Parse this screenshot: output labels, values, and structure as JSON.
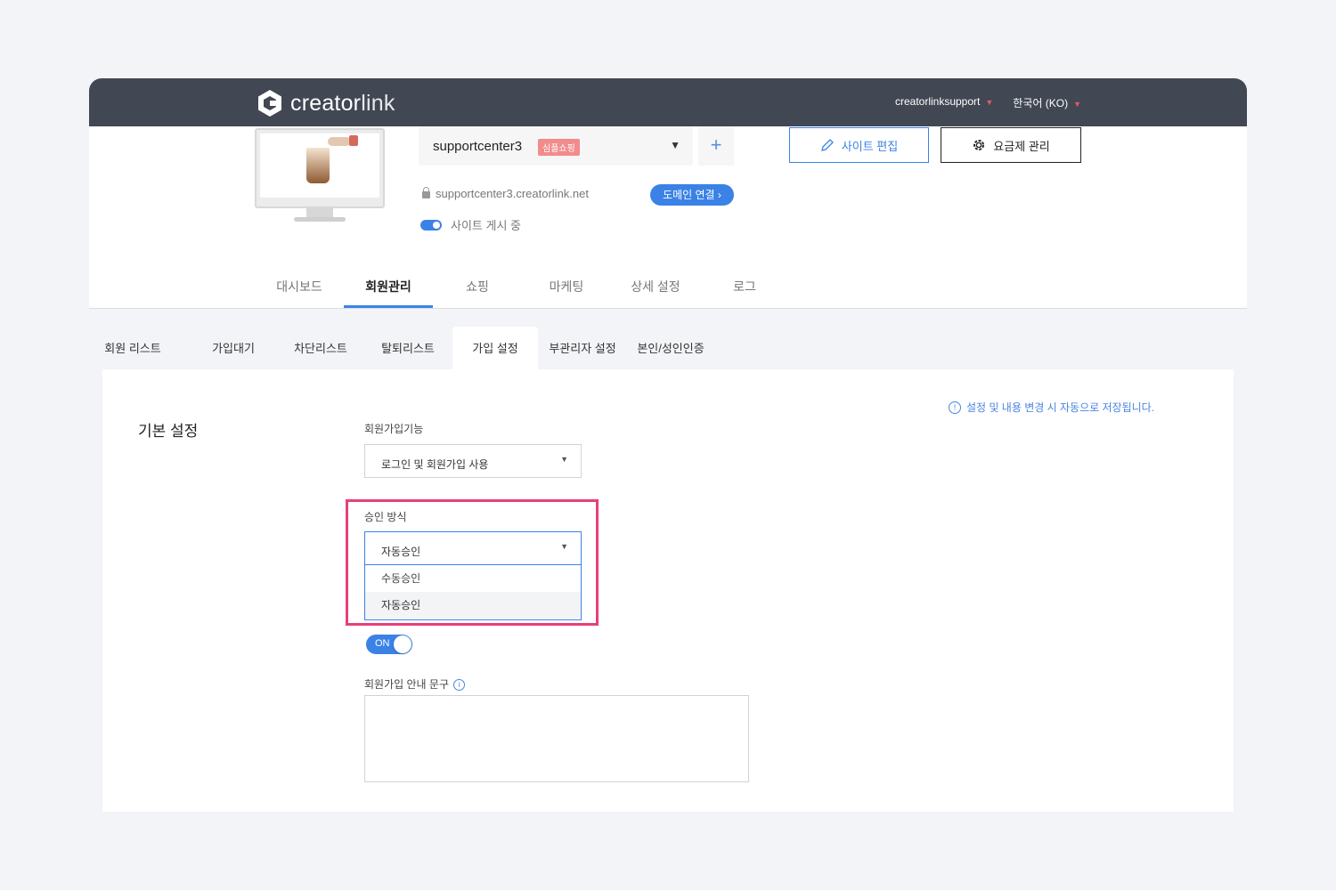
{
  "topbar": {
    "logo_main": "creator",
    "logo_suffix": "link",
    "account": "creatorlinksupport",
    "language": "한국어 (KO)"
  },
  "site": {
    "name": "supportcenter3",
    "badge": "심플쇼핑",
    "url": "supportcenter3.creatorlink.net",
    "domain_button": "도메인 연결 ›",
    "publish_status": "사이트 게시 중",
    "edit_button": "사이트 편집",
    "plan_button": "요금제 관리",
    "add_button": "+"
  },
  "main_tabs": [
    "대시보드",
    "회원관리",
    "쇼핑",
    "마케팅",
    "상세 설정",
    "로그"
  ],
  "sub_tabs": [
    "회원 리스트",
    "가입대기",
    "차단리스트",
    "탈퇴리스트",
    "가입 설정",
    "부관리자 설정",
    "본인/성인인증"
  ],
  "content": {
    "section_title": "기본 설정",
    "notice": "설정 및 내용 변경 시 자동으로 저장됩니다.",
    "signup_feature_label": "회원가입기능",
    "signup_feature_value": "로그인 및 회원가입 사용",
    "approval_label": "승인 방식",
    "approval_value": "자동승인",
    "approval_options": [
      "수동승인",
      "자동승인"
    ],
    "toggle_label": "ON",
    "guide_label": "회원가입 안내 문구",
    "guide_text": ""
  },
  "colors": {
    "accent": "#3b82e6",
    "topbar": "#414753",
    "highlight": "#e83e7a",
    "badge": "#f28b8b"
  }
}
